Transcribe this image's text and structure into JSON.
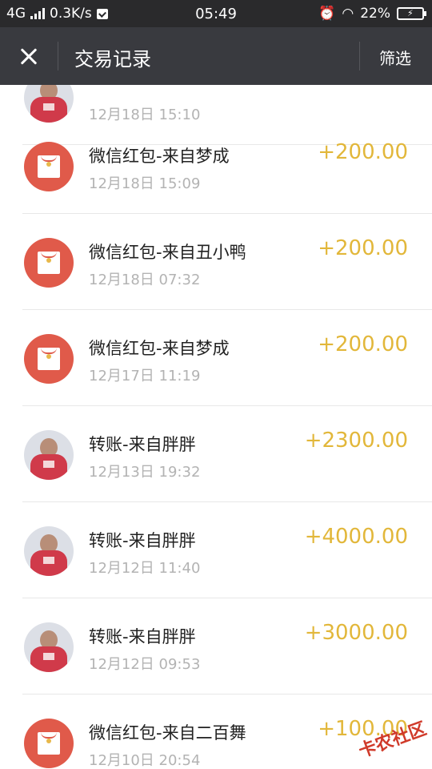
{
  "status_bar": {
    "network": "4G",
    "speed": "0.3K/s",
    "time": "05:49",
    "battery": "22%"
  },
  "header": {
    "title": "交易记录",
    "filter_label": "筛选"
  },
  "transactions": [
    {
      "title": "",
      "time": "12月18日 15:10",
      "amount": "",
      "icon": "avatar-photo"
    },
    {
      "title": "微信红包-来自梦成",
      "time": "12月18日 15:09",
      "amount": "+200.00",
      "icon": "red-packet-icon"
    },
    {
      "title": "微信红包-来自丑小鸭",
      "time": "12月18日 07:32",
      "amount": "+200.00",
      "icon": "red-packet-icon"
    },
    {
      "title": "微信红包-来自梦成",
      "time": "12月17日 11:19",
      "amount": "+200.00",
      "icon": "red-packet-icon"
    },
    {
      "title": "转账-来自胖胖",
      "time": "12月13日 19:32",
      "amount": "+2300.00",
      "icon": "avatar-photo"
    },
    {
      "title": "转账-来自胖胖",
      "time": "12月12日 11:40",
      "amount": "+4000.00",
      "icon": "avatar-photo"
    },
    {
      "title": "转账-来自胖胖",
      "time": "12月12日 09:53",
      "amount": "+3000.00",
      "icon": "avatar-photo"
    },
    {
      "title": "微信红包-来自二百舞",
      "time": "12月10日 20:54",
      "amount": "+100.00",
      "icon": "red-packet-icon"
    }
  ],
  "watermark": "卡农社区",
  "colors": {
    "amount": "#e2b73a",
    "red_packet": "#e05a4a",
    "title_bar": "#393a3f"
  }
}
